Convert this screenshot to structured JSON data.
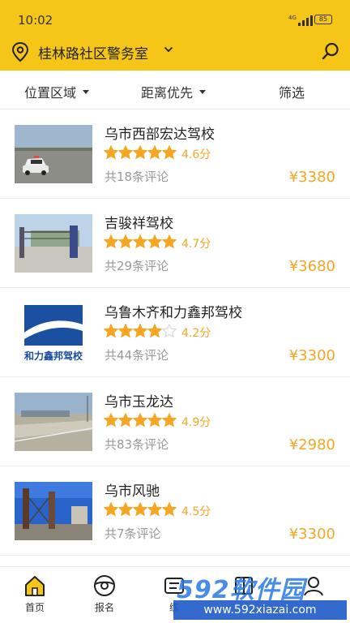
{
  "status_bar": {
    "time": "10:02",
    "network": "4G",
    "battery": "85"
  },
  "header": {
    "location": "桂林路社区警务室"
  },
  "filters": [
    {
      "label": "位置区域",
      "dropdown": true
    },
    {
      "label": "距离优先",
      "dropdown": true
    },
    {
      "label": "筛选",
      "dropdown": false
    }
  ],
  "schools": [
    {
      "name": "乌市西部宏达驾校",
      "rating": 4.6,
      "stars": 5,
      "score": "4.6分",
      "reviews": "共18条评论",
      "price": "¥3380"
    },
    {
      "name": "吉骏祥驾校",
      "rating": 4.7,
      "stars": 5,
      "score": "4.7分",
      "reviews": "共29条评论",
      "price": "¥3680"
    },
    {
      "name": "乌鲁木齐和力鑫邦驾校",
      "rating": 4.2,
      "stars": 4,
      "score": "4.2分",
      "reviews": "共44条评论",
      "price": "¥3300",
      "logo_text": "和力鑫邦驾校"
    },
    {
      "name": "乌市玉龙达",
      "rating": 4.9,
      "stars": 5,
      "score": "4.9分",
      "reviews": "共83条评论",
      "price": "¥2980"
    },
    {
      "name": "乌市风驰",
      "rating": 4.5,
      "stars": 5,
      "score": "4.5分",
      "reviews": "共7条评论",
      "price": "¥3300"
    }
  ],
  "tabs": [
    {
      "label": "首页",
      "icon": "home-icon"
    },
    {
      "label": "报名",
      "icon": "steering-wheel-icon"
    },
    {
      "label": "练",
      "icon": "practice-icon"
    },
    {
      "label": "",
      "icon": "book-icon"
    },
    {
      "label": "",
      "icon": "profile-icon"
    }
  ],
  "watermark": {
    "brand": "592软件园",
    "url": "www.592xiazai.com"
  },
  "colors": {
    "accent": "#F5C518",
    "price": "#F5A623",
    "star_on": "#F5A623",
    "star_off": "#d8d8d8",
    "logo_blue": "#1B4FA0"
  }
}
